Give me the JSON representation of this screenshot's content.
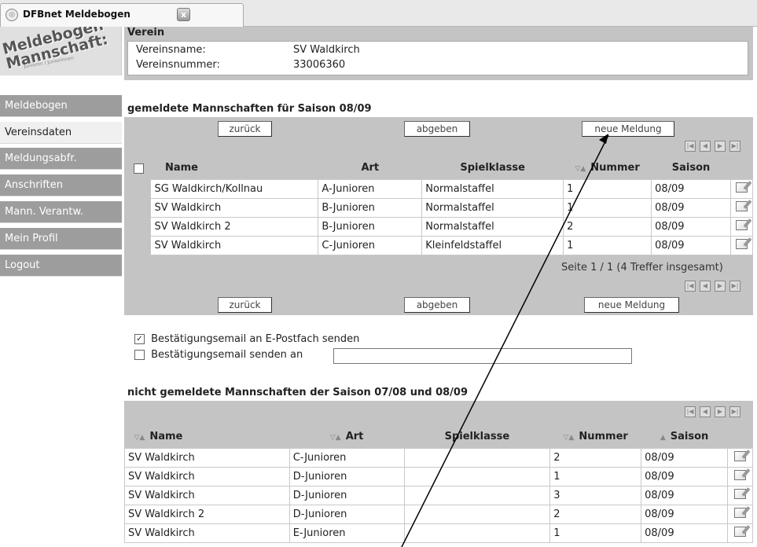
{
  "tab": {
    "title": "DFBnet Meldebogen",
    "close": "x"
  },
  "logo": {
    "line1": "Meldebogen",
    "line2": "Mannschaft:",
    "small": "Junioren / Juniorinnen"
  },
  "sidebar": {
    "items": [
      {
        "label": "Meldebogen"
      },
      {
        "label": "Vereinsdaten"
      },
      {
        "label": "Meldungsabfr."
      },
      {
        "label": "Anschriften"
      },
      {
        "label": "Mann. Verantw."
      },
      {
        "label": "Mein Profil"
      },
      {
        "label": "Logout"
      }
    ]
  },
  "verein": {
    "title": "Verein",
    "name_label": "Vereinsname:",
    "name_value": "SV Waldkirch",
    "number_label": "Vereinsnummer:",
    "number_value": "33006360"
  },
  "gemeldet": {
    "title": "gemeldete Mannschaften für Saison 08/09",
    "buttons": {
      "back": "zurück",
      "submit": "abgeben",
      "new": "neue Meldung"
    },
    "columns": [
      "Name",
      "Art",
      "Spielklasse",
      "Nummer",
      "Saison"
    ],
    "rows": [
      {
        "name": "SG Waldkirch/Kollnau",
        "art": "A-Junioren",
        "klasse": "Normalstaffel",
        "nummer": "1",
        "saison": "08/09"
      },
      {
        "name": "SV Waldkirch",
        "art": "B-Junioren",
        "klasse": "Normalstaffel",
        "nummer": "1",
        "saison": "08/09"
      },
      {
        "name": "SV Waldkirch 2",
        "art": "B-Junioren",
        "klasse": "Normalstaffel",
        "nummer": "2",
        "saison": "08/09"
      },
      {
        "name": "SV Waldkirch",
        "art": "C-Junioren",
        "klasse": "Kleinfeldstaffel",
        "nummer": "1",
        "saison": "08/09"
      }
    ],
    "result": "Seite 1 / 1 (4 Treffer insgesamt)"
  },
  "email": {
    "option1": "Bestätigungsemail an E-Postfach senden",
    "option2": "Bestätigungsemail senden an",
    "option1_checked": true,
    "option2_checked": false,
    "address_value": ""
  },
  "nicht_gemeldet": {
    "title": "nicht gemeldete Mannschaften der Saison 07/08 und 08/09",
    "columns": [
      "Name",
      "Art",
      "Spielklasse",
      "Nummer",
      "Saison"
    ],
    "rows": [
      {
        "name": "SV Waldkirch",
        "art": "C-Junioren",
        "klasse": "",
        "nummer": "2",
        "saison": "08/09"
      },
      {
        "name": "SV Waldkirch",
        "art": "D-Junioren",
        "klasse": "",
        "nummer": "1",
        "saison": "08/09"
      },
      {
        "name": "SV Waldkirch",
        "art": "D-Junioren",
        "klasse": "",
        "nummer": "3",
        "saison": "08/09"
      },
      {
        "name": "SV Waldkirch 2",
        "art": "D-Junioren",
        "klasse": "",
        "nummer": "2",
        "saison": "08/09"
      },
      {
        "name": "SV Waldkirch",
        "art": "E-Junioren",
        "klasse": "",
        "nummer": "1",
        "saison": "08/09"
      }
    ]
  },
  "colors": {
    "panel": "#c4c4c4",
    "sidebar": "#9d9d9d",
    "sidebar_active": "#f0f0f0"
  }
}
